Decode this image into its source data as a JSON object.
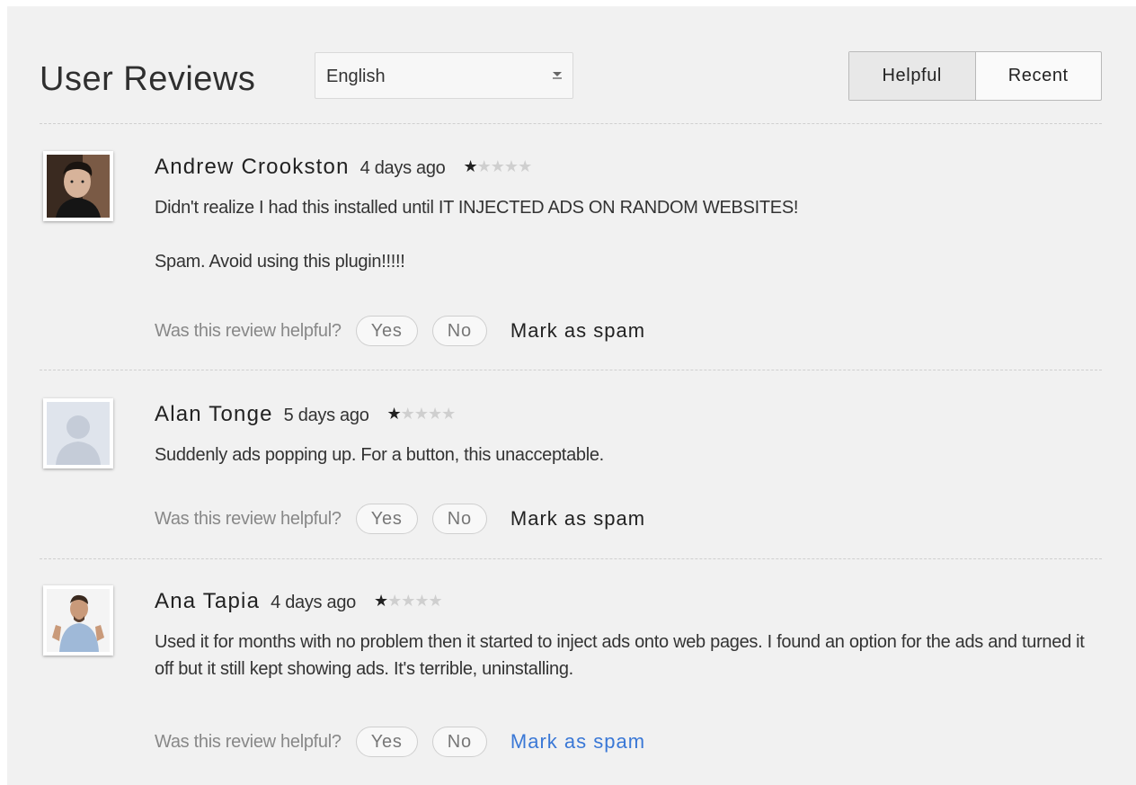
{
  "header": {
    "title": "User Reviews",
    "language_select": {
      "value": "English"
    },
    "sort_tabs": [
      {
        "label": "Helpful",
        "active": true
      },
      {
        "label": "Recent",
        "active": false
      }
    ]
  },
  "feedback_prompt": "Was this review helpful?",
  "yes_label": "Yes",
  "no_label": "No",
  "spam_label": "Mark as spam",
  "reviews": [
    {
      "author": "Andrew Crookston",
      "date": "4 days ago",
      "rating": 1,
      "max_rating": 5,
      "paragraphs": [
        "Didn't realize I had this installed until IT INJECTED ADS ON RANDOM WEBSITES!",
        "Spam. Avoid using this plugin!!!!!"
      ],
      "avatar": "photo-man-dark-background"
    },
    {
      "author": "Alan Tonge",
      "date": "5 days ago",
      "rating": 1,
      "max_rating": 5,
      "paragraphs": [
        "Suddenly ads popping up. For a button, this unacceptable."
      ],
      "avatar": "default-silhouette"
    },
    {
      "author": "Ana Tapia",
      "date": "4 days ago",
      "rating": 1,
      "max_rating": 5,
      "paragraphs": [
        "Used it for months with no problem then it started to inject ads onto web pages. I found an option for the ads and turned it off but it still kept showing ads. It's terrible, uninstalling."
      ],
      "avatar": "photo-man-raised-hands"
    }
  ],
  "colors": {
    "panel_background": "#f1f1f1",
    "link_blue": "#3a78d6",
    "star_filled": "#222222",
    "star_empty": "#cfcfcf"
  }
}
